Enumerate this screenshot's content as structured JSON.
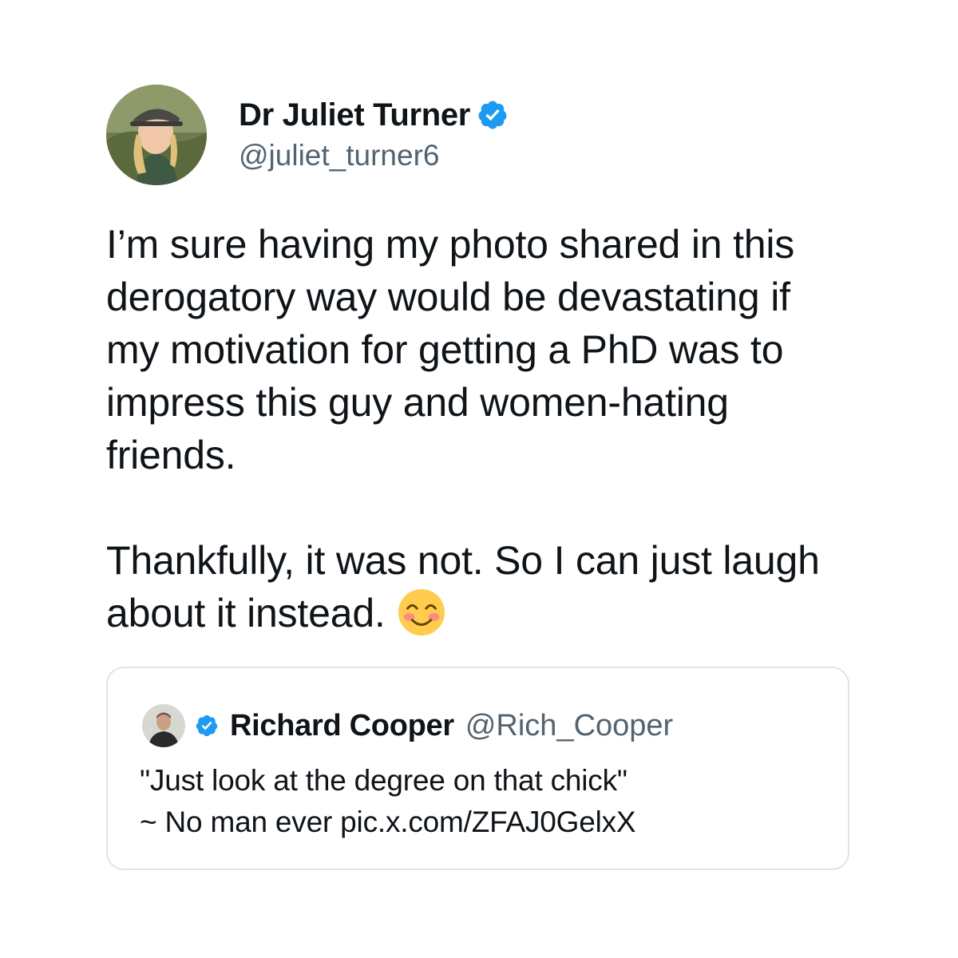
{
  "tweet": {
    "display_name": "Dr Juliet Turner",
    "handle": "@juliet_turner6",
    "verified_icon": "verified-badge-icon",
    "paragraph_1": "I’m sure having my photo shared in this derogatory way would be devastating if my motivation for getting a PhD was to impress this guy and women-hating friends.",
    "paragraph_2": "Thankfully, it was not. So I can just laugh about it instead.",
    "emoji": "smiling-face-with-smiling-eyes-emoji"
  },
  "quoted_tweet": {
    "display_name": "Richard Cooper",
    "handle": "@Rich_Cooper",
    "verified_icon": "verified-badge-icon",
    "line_1": "\"Just look at the degree on that chick\"",
    "line_2": "~ No man ever pic.x.com/ZFAJ0GelxX"
  },
  "colors": {
    "text": "#0f1419",
    "secondary_text": "#536471",
    "verified_blue": "#1d9bf0",
    "quote_border": "#dfe3e7"
  }
}
